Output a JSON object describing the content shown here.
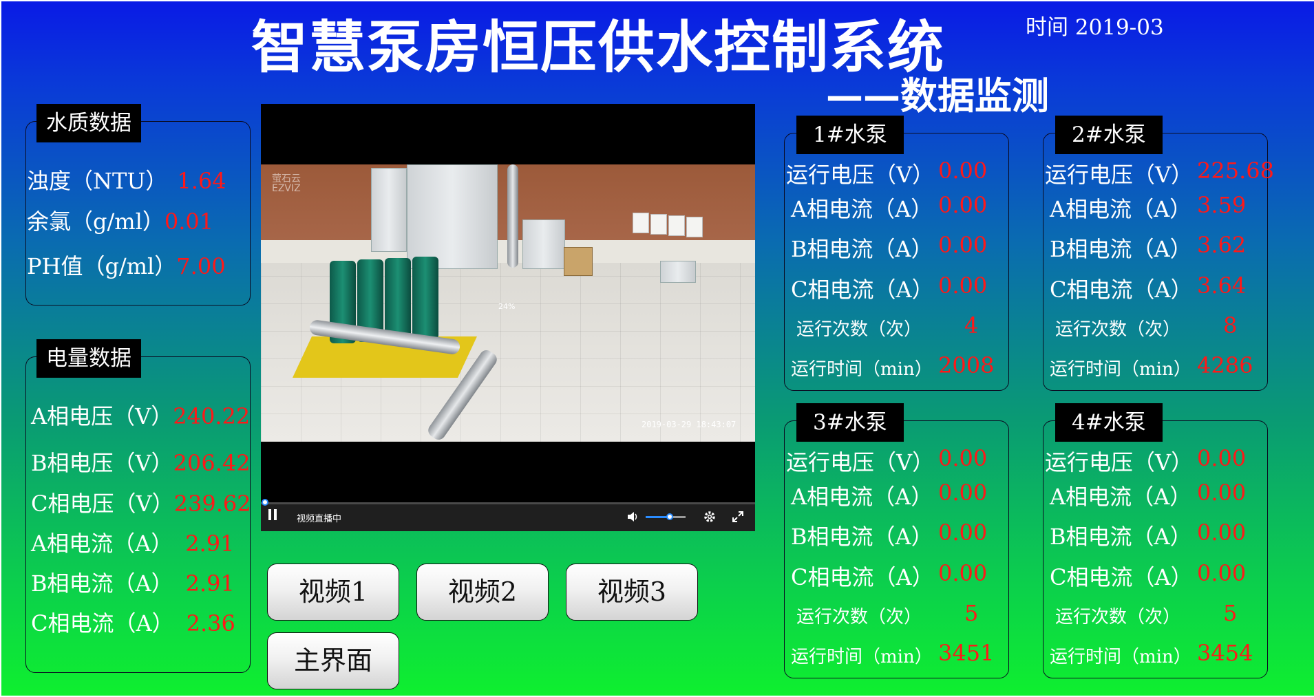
{
  "header": {
    "title": "智慧泵房恒压供水控制系统",
    "subtitle": "——数据监测",
    "time_label": "时间",
    "time_value": "2019-03"
  },
  "water_quality": {
    "title": "水质数据",
    "rows": [
      {
        "label": "浊度（NTU）",
        "value": "1.64"
      },
      {
        "label": "余氯（g/ml）",
        "value": "0.01"
      },
      {
        "label": "PH值（g/ml）",
        "value": "7.00"
      }
    ]
  },
  "power": {
    "title": "电量数据",
    "rows": [
      {
        "label": "A相电压（V）",
        "value": "240.22"
      },
      {
        "label": "B相电压（V）",
        "value": "206.42"
      },
      {
        "label": "C相电压（V）",
        "value": "239.62"
      },
      {
        "label": "A相电流（A）",
        "value": "2.91"
      },
      {
        "label": "B相电流（A）",
        "value": "2.91"
      },
      {
        "label": "C相电流（A）",
        "value": "2.36"
      }
    ]
  },
  "video": {
    "logo_line1": "萤石云",
    "logo_line2": "EZVIZ",
    "timestamp": "2019-03-29 18:43:07",
    "buffer_percent": "24%",
    "live_status": "视频直播中",
    "volume_level": 0.6,
    "icons": {
      "play": "pause-icon",
      "volume": "volume-icon",
      "settings": "gear-icon",
      "fullscreen": "fullscreen-icon"
    }
  },
  "buttons": {
    "video1": "视频1",
    "video2": "视频2",
    "video3": "视频3",
    "main": "主界面"
  },
  "pumps": [
    {
      "title": "1#水泵",
      "voltage": "0.00",
      "ia": "0.00",
      "ib": "0.00",
      "ic": "0.00",
      "runs": "4",
      "runtime": "2008"
    },
    {
      "title": "2#水泵",
      "voltage": "225.68",
      "ia": "3.59",
      "ib": "3.62",
      "ic": "3.64",
      "runs": "8",
      "runtime": "4286"
    },
    {
      "title": "3#水泵",
      "voltage": "0.00",
      "ia": "0.00",
      "ib": "0.00",
      "ic": "0.00",
      "runs": "5",
      "runtime": "3451"
    },
    {
      "title": "4#水泵",
      "voltage": "0.00",
      "ia": "0.00",
      "ib": "0.00",
      "ic": "0.00",
      "runs": "5",
      "runtime": "3454"
    }
  ],
  "pump_labels": {
    "voltage": "运行电压（V）",
    "ia": "A相电流（A）",
    "ib": "B相电流（A）",
    "ic": "C相电流（A）",
    "runs": "运行次数（次）",
    "runtime": "运行时间（min）"
  },
  "colors": {
    "value": "#ff1818",
    "label": "#ffffff",
    "panel_title_bg": "#000000"
  }
}
